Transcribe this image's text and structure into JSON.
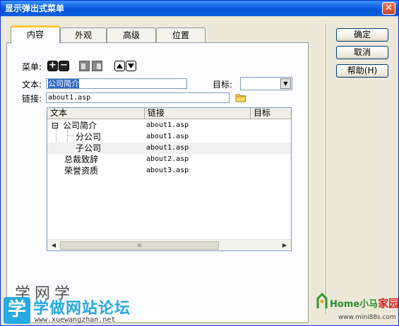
{
  "window": {
    "title": "显示弹出式菜单",
    "close_glyph": "✕"
  },
  "tabs": [
    {
      "label": "内容",
      "active": true
    },
    {
      "label": "外观"
    },
    {
      "label": "高级"
    },
    {
      "label": "位置"
    }
  ],
  "menu_row": {
    "label": "菜单:",
    "add_glyph": "+",
    "remove_glyph": "−"
  },
  "text_field": {
    "label": "文本:",
    "value": "公司简介"
  },
  "target": {
    "label": "目标:",
    "value": ""
  },
  "link_field": {
    "label": "链接:",
    "value": "about1.asp"
  },
  "list": {
    "columns": [
      "文本",
      "链接",
      "目标"
    ],
    "rows": [
      {
        "name": "公司简介",
        "link": "about1.asp",
        "expander": "⊟",
        "level": 0
      },
      {
        "name": "分公司",
        "link": "about1.asp",
        "level": 1
      },
      {
        "name": "子公司",
        "link": "about1.asp",
        "level": 1,
        "highlight": true
      },
      {
        "name": "总裁致辞",
        "link": "about2.asp",
        "level": 0
      },
      {
        "name": "荣誉资质",
        "link": "about3.asp",
        "level": 0
      }
    ],
    "scroll_thumb_glyph": "III"
  },
  "buttons": {
    "ok": "确定",
    "cancel": "取消",
    "help": "帮助(H)"
  },
  "watermark_left": {
    "badge": "学",
    "title": "学做网站论坛",
    "url": "www.xuewangzhan.net",
    "faint": "学网学"
  },
  "watermark_right": {
    "brand": "Home小马",
    "brand_accent": "家园",
    "url": "www.mini88s.com"
  },
  "colors": {
    "title_bar": "#0a5fe0",
    "selection": "#316ac5",
    "tab_accent": "#ffc83c",
    "watermark_blue": "#27a9e1"
  }
}
